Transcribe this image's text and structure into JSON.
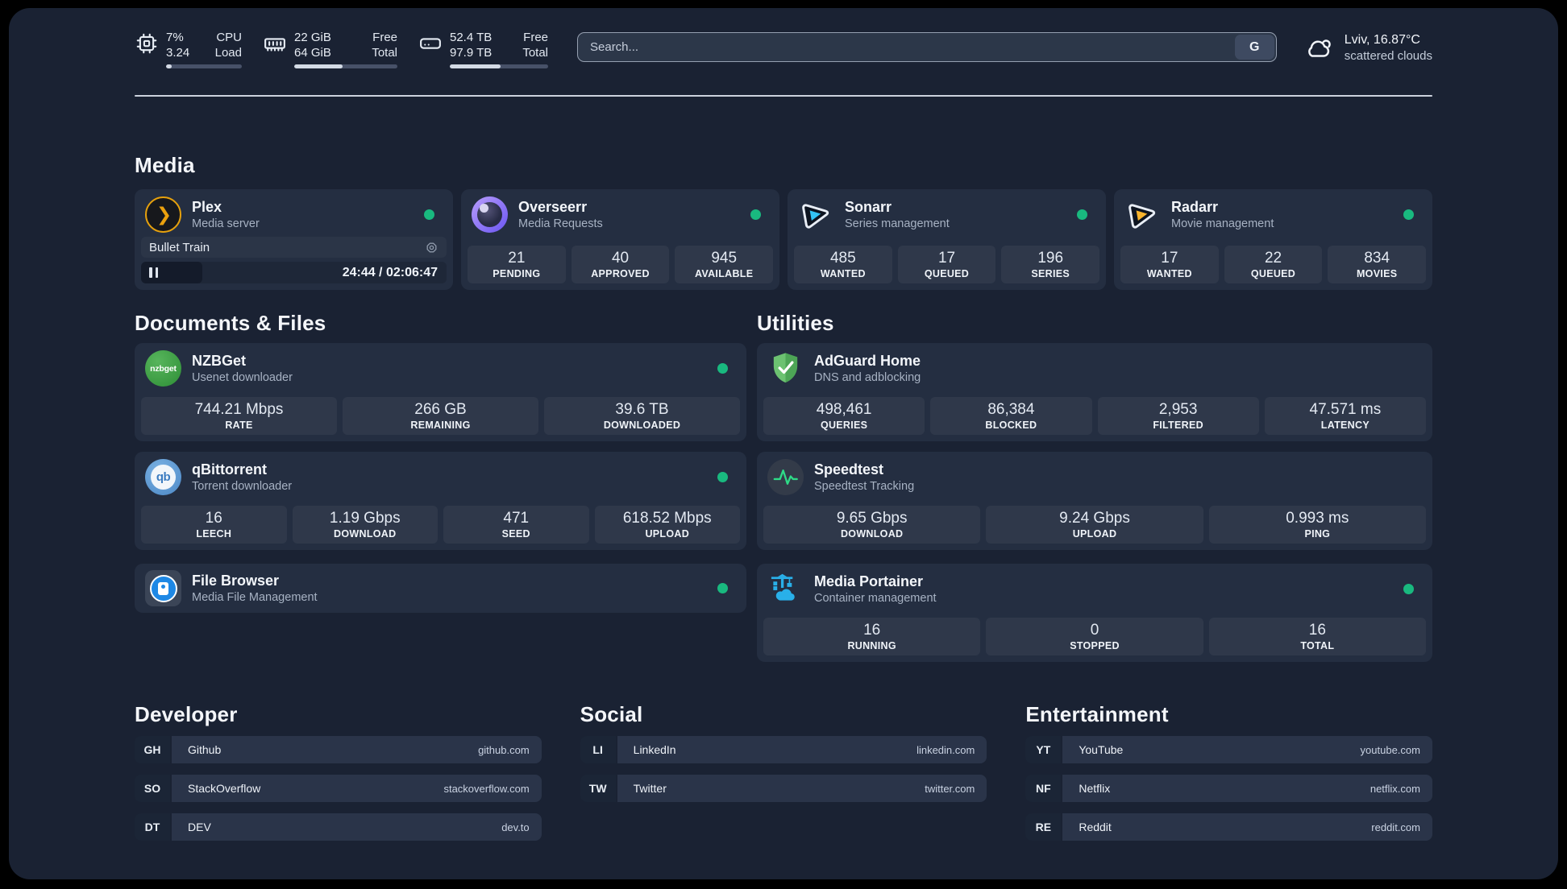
{
  "topbar": {
    "stats": [
      {
        "icon": "cpu",
        "values": [
          "7%",
          "3.24"
        ],
        "labels": [
          "CPU",
          "Load"
        ],
        "progress": 7
      },
      {
        "icon": "memory",
        "values": [
          "22 GiB",
          "64 GiB"
        ],
        "labels": [
          "Free",
          "Total"
        ],
        "progress": 47
      },
      {
        "icon": "disk",
        "values": [
          "52.4 TB",
          "97.9 TB"
        ],
        "labels": [
          "Free",
          "Total"
        ],
        "progress": 52
      }
    ],
    "search": {
      "placeholder": "Search...",
      "engine_button": "G"
    },
    "weather": {
      "location": "Lviv, 16.87°C",
      "condition": "scattered clouds"
    }
  },
  "media": {
    "title": "Media",
    "apps": [
      {
        "name": "Plex",
        "desc": "Media server",
        "status_dot": true,
        "player": {
          "title": "Bullet Train",
          "time": "24:44 / 02:06:47",
          "progress": 20
        }
      },
      {
        "name": "Overseerr",
        "desc": "Media Requests",
        "status_dot": true,
        "stats": [
          {
            "value": "21",
            "label": "PENDING"
          },
          {
            "value": "40",
            "label": "APPROVED"
          },
          {
            "value": "945",
            "label": "AVAILABLE"
          }
        ]
      },
      {
        "name": "Sonarr",
        "desc": "Series management",
        "status_dot": true,
        "stats": [
          {
            "value": "485",
            "label": "WANTED"
          },
          {
            "value": "17",
            "label": "QUEUED"
          },
          {
            "value": "196",
            "label": "SERIES"
          }
        ]
      },
      {
        "name": "Radarr",
        "desc": "Movie management",
        "status_dot": true,
        "stats": [
          {
            "value": "17",
            "label": "WANTED"
          },
          {
            "value": "22",
            "label": "QUEUED"
          },
          {
            "value": "834",
            "label": "MOVIES"
          }
        ]
      }
    ]
  },
  "documents": {
    "title": "Documents & Files",
    "apps": [
      {
        "name": "NZBGet",
        "desc": "Usenet downloader",
        "status_dot": true,
        "stats": [
          {
            "value": "744.21 Mbps",
            "label": "RATE"
          },
          {
            "value": "266 GB",
            "label": "REMAINING"
          },
          {
            "value": "39.6 TB",
            "label": "DOWNLOADED"
          }
        ]
      },
      {
        "name": "qBittorrent",
        "desc": "Torrent downloader",
        "status_dot": true,
        "stats": [
          {
            "value": "16",
            "label": "LEECH"
          },
          {
            "value": "1.19 Gbps",
            "label": "DOWNLOAD"
          },
          {
            "value": "471",
            "label": "SEED"
          },
          {
            "value": "618.52 Mbps",
            "label": "UPLOAD"
          }
        ]
      },
      {
        "name": "File Browser",
        "desc": "Media File Management",
        "status_dot": true,
        "stats": []
      }
    ]
  },
  "utilities": {
    "title": "Utilities",
    "apps": [
      {
        "name": "AdGuard Home",
        "desc": "DNS and adblocking",
        "status_dot": false,
        "stats": [
          {
            "value": "498,461",
            "label": "QUERIES"
          },
          {
            "value": "86,384",
            "label": "BLOCKED"
          },
          {
            "value": "2,953",
            "label": "FILTERED"
          },
          {
            "value": "47.571 ms",
            "label": "LATENCY"
          }
        ]
      },
      {
        "name": "Speedtest",
        "desc": "Speedtest Tracking",
        "status_dot": false,
        "stats": [
          {
            "value": "9.65 Gbps",
            "label": "DOWNLOAD"
          },
          {
            "value": "9.24 Gbps",
            "label": "UPLOAD"
          },
          {
            "value": "0.993 ms",
            "label": "PING"
          }
        ]
      },
      {
        "name": "Media Portainer",
        "desc": "Container management",
        "status_dot": true,
        "stats": [
          {
            "value": "16",
            "label": "RUNNING"
          },
          {
            "value": "0",
            "label": "STOPPED"
          },
          {
            "value": "16",
            "label": "TOTAL"
          }
        ]
      }
    ]
  },
  "links": {
    "developer": {
      "title": "Developer",
      "items": [
        {
          "abbr": "GH",
          "name": "Github",
          "url": "github.com"
        },
        {
          "abbr": "SO",
          "name": "StackOverflow",
          "url": "stackoverflow.com"
        },
        {
          "abbr": "DT",
          "name": "DEV",
          "url": "dev.to"
        }
      ]
    },
    "social": {
      "title": "Social",
      "items": [
        {
          "abbr": "LI",
          "name": "LinkedIn",
          "url": "linkedin.com"
        },
        {
          "abbr": "TW",
          "name": "Twitter",
          "url": "twitter.com"
        }
      ]
    },
    "entertainment": {
      "title": "Entertainment",
      "items": [
        {
          "abbr": "YT",
          "name": "YouTube",
          "url": "youtube.com"
        },
        {
          "abbr": "NF",
          "name": "Netflix",
          "url": "netflix.com"
        },
        {
          "abbr": "RE",
          "name": "Reddit",
          "url": "reddit.com"
        }
      ]
    }
  },
  "colors": {
    "background": "#1a2233",
    "card": "#242e41",
    "status_online": "#19b97f",
    "plex_accent": "#e5a00d",
    "sonarr_accent": "#33c3f5",
    "radarr_accent": "#f9b42d",
    "nzbget_accent": "#3d9f43",
    "qbittorrent_accent": "#4a87c6",
    "adguard_accent": "#5cb966",
    "speedtest_accent": "#2edb87",
    "portainer_accent": "#29b0e9",
    "progress_fill": "#d3dae5"
  }
}
